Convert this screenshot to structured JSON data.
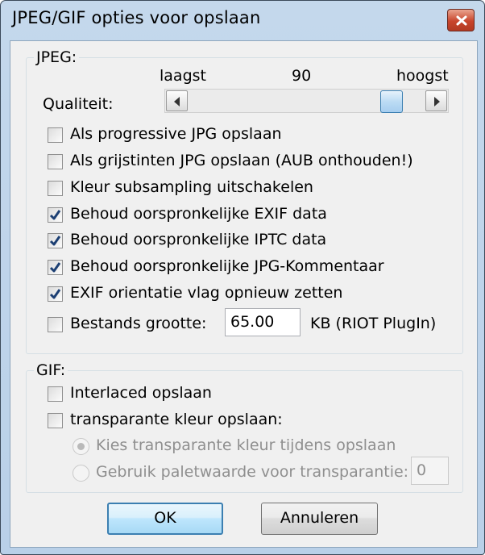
{
  "window": {
    "title": "JPEG/GIF opties voor opslaan"
  },
  "jpeg": {
    "legend": "JPEG:",
    "slider": {
      "min_label": "laagst",
      "value": "90",
      "max_label": "hoogst",
      "quality_label": "Qualiteit:",
      "position_fraction": 0.9
    },
    "options": [
      {
        "label": "Als progressive JPG opslaan",
        "checked": false
      },
      {
        "label": "Als grijstinten JPG opslaan (AUB onthouden!)",
        "checked": false
      },
      {
        "label": "Kleur subsampling uitschakelen",
        "checked": false
      },
      {
        "label": "Behoud oorspronkelijke EXIF data",
        "checked": true
      },
      {
        "label": "Behoud oorspronkelijke IPTC data",
        "checked": true
      },
      {
        "label": "Behoud oorspronkelijke JPG-Kommentaar",
        "checked": true
      },
      {
        "label": "EXIF orientatie vlag opnieuw zetten",
        "checked": true
      }
    ],
    "filesize": {
      "label": "Bestands grootte:",
      "value": "65.00",
      "unit": "KB (RIOT PlugIn)",
      "checked": false
    }
  },
  "gif": {
    "legend": "GIF:",
    "interlaced": {
      "label": "Interlaced opslaan",
      "checked": false
    },
    "transparent": {
      "label": "transparante kleur opslaan:",
      "checked": false
    },
    "radio_choose": {
      "label": "Kies transparante kleur tijdens opslaan",
      "selected": true,
      "enabled": false
    },
    "radio_palette": {
      "label": "Gebruik paletwaarde voor transparantie:",
      "selected": false,
      "enabled": false,
      "value": "0"
    }
  },
  "buttons": {
    "ok": "OK",
    "cancel": "Annuleren"
  }
}
